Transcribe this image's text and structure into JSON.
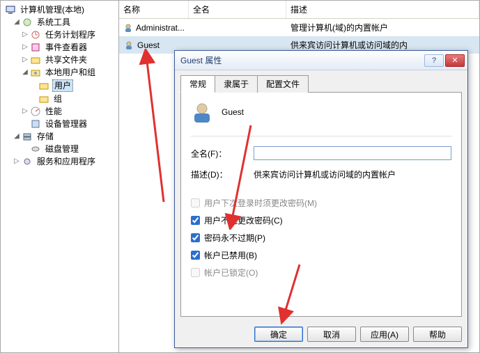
{
  "tree": {
    "root": "计算机管理(本地)",
    "n_systools": "系统工具",
    "n_tasksched": "任务计划程序",
    "n_eventvwr": "事件查看器",
    "n_shared": "共享文件夹",
    "n_localusers": "本地用户和组",
    "n_users": "用户",
    "n_groups": "组",
    "n_perf": "性能",
    "n_devmgr": "设备管理器",
    "n_storage": "存储",
    "n_diskmgmt": "磁盘管理",
    "n_services": "服务和应用程序"
  },
  "list": {
    "h_name": "名称",
    "h_full": "全名",
    "h_desc": "描述",
    "rows": [
      {
        "name": "Administrat...",
        "full": "",
        "desc": "管理计算机(域)的内置帐户"
      },
      {
        "name": "Guest",
        "full": "",
        "desc": "供来宾访问计算机或访问域的内"
      }
    ]
  },
  "dialog": {
    "title": "Guest 属性",
    "tabs": {
      "t1": "常规",
      "t2": "隶属于",
      "t3": "配置文件"
    },
    "username": "Guest",
    "f_full_label": "全名(F)：",
    "f_full_value": "",
    "f_desc_label": "描述(D)：",
    "f_desc_value": "供来宾访问计算机或访问域的内置帐户",
    "cb_mustchange": "用户下次登录时须更改密码(M)",
    "cb_cannotchange": "用户不能更改密码(C)",
    "cb_neverexpire": "密码永不过期(P)",
    "cb_disabled": "帐户已禁用(B)",
    "cb_locked": "帐户已锁定(O)",
    "btn_ok": "确定",
    "btn_cancel": "取消",
    "btn_apply": "应用(A)",
    "btn_help": "帮助"
  },
  "glyph": {
    "collapsed": "▷",
    "expanded": "◢",
    "help": "?",
    "close": "✕"
  }
}
